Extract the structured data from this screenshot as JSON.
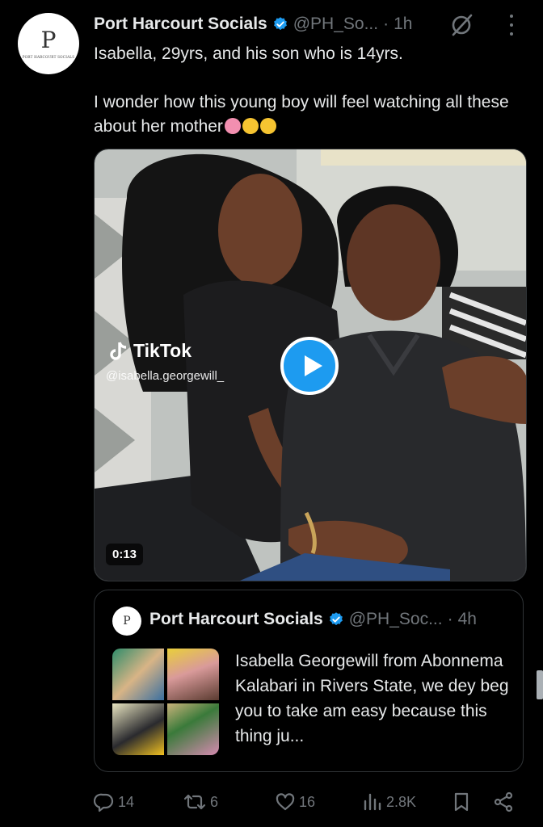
{
  "account": {
    "name": "Port Harcourt Socials",
    "handle": "@PH_So...",
    "dot": "·",
    "time": "1h",
    "avatar_monogram": "P",
    "avatar_caption": "PORT HARCOURT SOCIALS"
  },
  "tweet": {
    "line1": "Isabella, 29yrs, and his son who is 14yrs.",
    "line2": "I wonder how this young boy will feel watching all these about her mother"
  },
  "media": {
    "watermark_brand": "TikTok",
    "watermark_handle": "@isabella.georgewill_",
    "duration": "0:13"
  },
  "quote": {
    "name": "Port Harcourt Socials",
    "handle": "@PH_Soc...",
    "dot": "·",
    "time": "4h",
    "avatar_monogram": "P",
    "text": "Isabella Georgewill from Abonnema Kalabari in Rivers State, we dey beg you to take am easy because this thing ju..."
  },
  "actions": {
    "replies": "14",
    "reposts": "6",
    "likes": "16",
    "views": "2.8K"
  },
  "colors": {
    "accent": "#1d9bf0",
    "muted": "#71767b",
    "background": "#000000"
  },
  "icons": [
    "verified-icon",
    "grok-icon",
    "more-icon",
    "play-icon",
    "reply-icon",
    "repost-icon",
    "like-icon",
    "views-icon",
    "bookmark-icon",
    "share-icon"
  ]
}
